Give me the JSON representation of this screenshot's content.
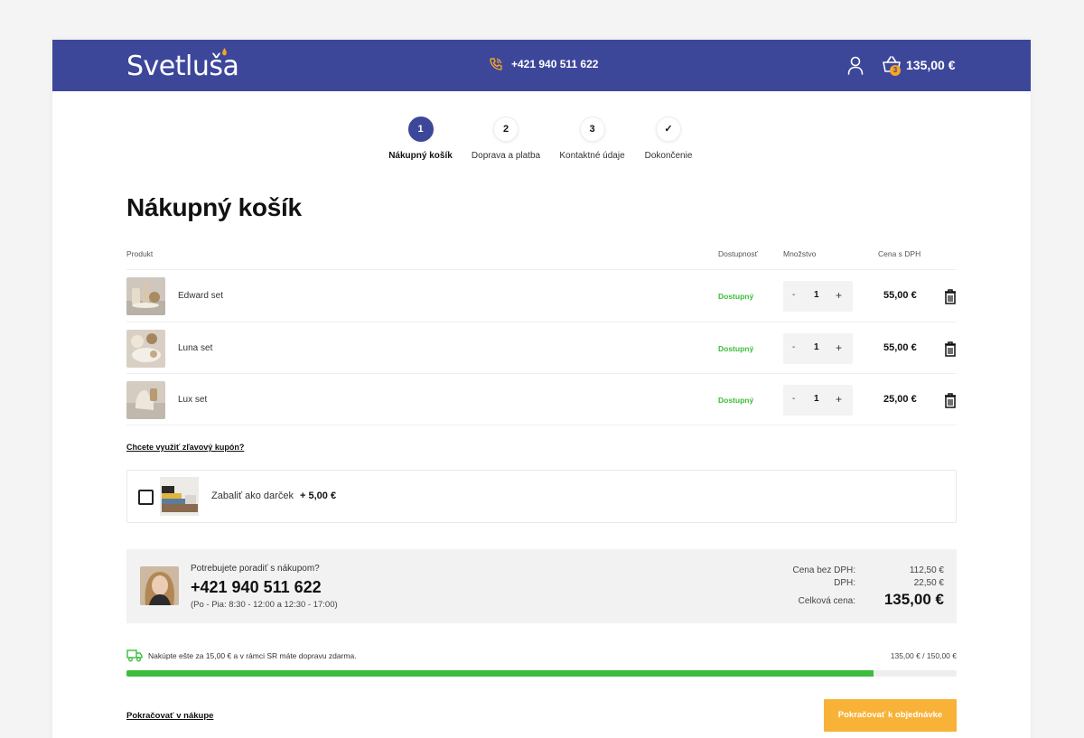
{
  "header": {
    "logo": "Svetluša",
    "phone": "+421 940 511 622",
    "cart_count": "3",
    "cart_total": "135,00 €"
  },
  "steps": [
    {
      "number": "1",
      "label": "Nákupný košík",
      "active": true
    },
    {
      "number": "2",
      "label": "Doprava a platba",
      "active": false
    },
    {
      "number": "3",
      "label": "Kontaktné údaje",
      "active": false
    },
    {
      "number": "✓",
      "label": "Dokončenie",
      "active": false
    }
  ],
  "page_title": "Nákupný košík",
  "table": {
    "headers": {
      "product": "Produkt",
      "availability": "Dostupnosť",
      "quantity": "Množstvo",
      "price": "Cena s DPH"
    },
    "rows": [
      {
        "name": "Edward set",
        "availability": "Dostupný",
        "qty": "1",
        "price": "55,00 €",
        "minus": "-",
        "plus": "+"
      },
      {
        "name": "Luna set",
        "availability": "Dostupný",
        "qty": "1",
        "price": "55,00 €",
        "minus": "-",
        "plus": "+"
      },
      {
        "name": "Lux set",
        "availability": "Dostupný",
        "qty": "1",
        "price": "25,00 €",
        "minus": "-",
        "plus": "+"
      }
    ]
  },
  "coupon_link": "Chcete využiť zľavový kupón?",
  "gift": {
    "label": "Zabaliť ako darček",
    "price": "+ 5,00 €"
  },
  "help": {
    "question": "Potrebujete poradiť s nákupom?",
    "phone": "+421 940 511 622",
    "hours": "(Po - Pia: 8:30 - 12:00 a 12:30 - 17:00)"
  },
  "summary": {
    "net_label": "Cena bez DPH:",
    "net_value": "112,50 €",
    "vat_label": "DPH:",
    "vat_value": "22,50 €",
    "total_label": "Celková cena:",
    "total_value": "135,00 €"
  },
  "shipping": {
    "text": "Nakúpte ešte za 15,00 € a v rámci SR máte dopravu zdarma.",
    "amount": "135,00 € / 150,00 €",
    "progress": 0.9
  },
  "footer": {
    "continue_link": "Pokračovať v nákupe",
    "order_button": "Pokračovať k objednávke"
  },
  "colors": {
    "header_bg": "#3d479a",
    "accent": "#f8b238",
    "available": "#3dbd3d"
  }
}
